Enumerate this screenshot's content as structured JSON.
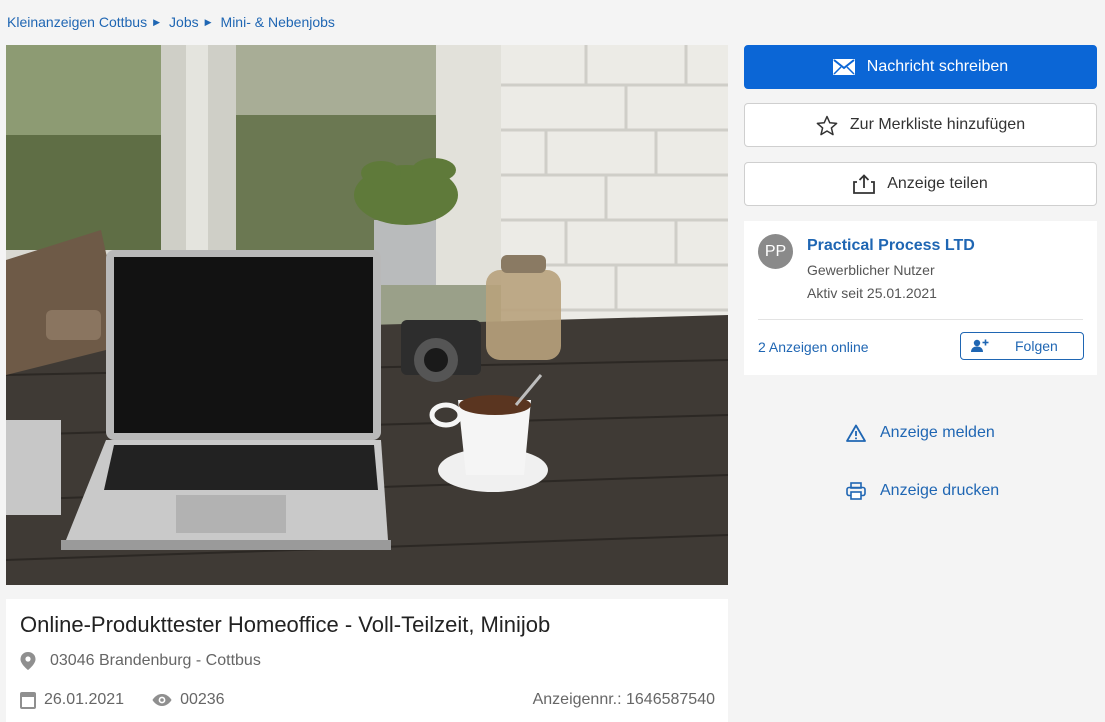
{
  "breadcrumb": [
    "Kleinanzeigen Cottbus",
    "Jobs",
    "Mini- & Nebenjobs"
  ],
  "listing": {
    "title": "Online-Produkttester Homeoffice - Voll-Teilzeit, Minijob",
    "location": "03046 Brandenburg - Cottbus",
    "date": "26.01.2021",
    "views": "00236",
    "ad_number": "Anzeigennr.: 1646587540"
  },
  "actions": {
    "message": "Nachricht schreiben",
    "watchlist": "Zur Merkliste hinzufügen",
    "share": "Anzeige teilen",
    "report": "Anzeige melden",
    "print": "Anzeige drucken"
  },
  "seller": {
    "initials": "PP",
    "name": "Practical Process LTD",
    "type": "Gewerblicher Nutzer",
    "active_since": "Aktiv seit 25.01.2021",
    "ads_online": "2 Anzeigen online",
    "follow": "Folgen"
  },
  "colors": {
    "primary": "#0b66d6",
    "link": "#1f66b3",
    "background": "#f4f4f4"
  },
  "icons": [
    "envelope-icon",
    "star-icon",
    "share-icon",
    "follow-user-icon",
    "warning-icon",
    "printer-icon",
    "location-pin-icon",
    "calendar-icon",
    "eye-icon"
  ]
}
